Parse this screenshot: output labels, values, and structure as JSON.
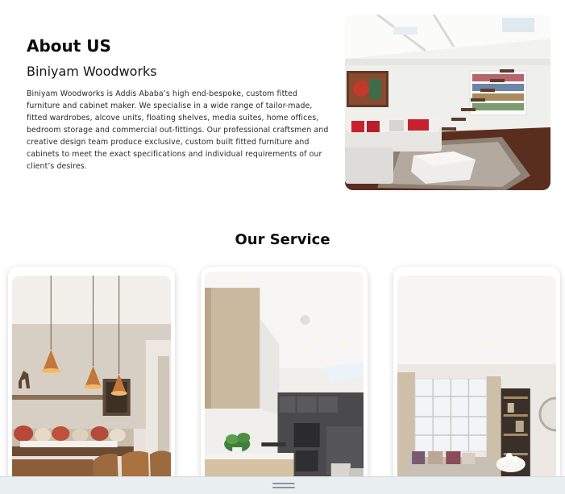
{
  "about": {
    "title": "About US",
    "subtitle": "Biniyam Woodworks",
    "body": "Biniyam Woodworks is Addis Ababa’s high end-bespoke, custom fitted furniture and cabinet maker. We specialise in a wide range of tailor-made, fitted wardrobes, alcove units, floating shelves, media suites, home offices, bedroom storage and commercial out-fittings. Our professional craftsmen and creative design team produce exclusive, custom built fitted furniture and cabinets to meet the exact specifications and individual requirements of our client’s desires."
  },
  "services": {
    "title": "Our Service",
    "cards": [
      {
        "image": "dining-room-pendant-lights-photo"
      },
      {
        "image": "modern-kitchen-photo"
      },
      {
        "image": "living-room-bay-window-photo"
      }
    ]
  },
  "hero": {
    "image": "living-room-staircase-photo"
  },
  "colors": {
    "text": "#0d0d0d",
    "bottom_bar": "#e9eef1"
  }
}
